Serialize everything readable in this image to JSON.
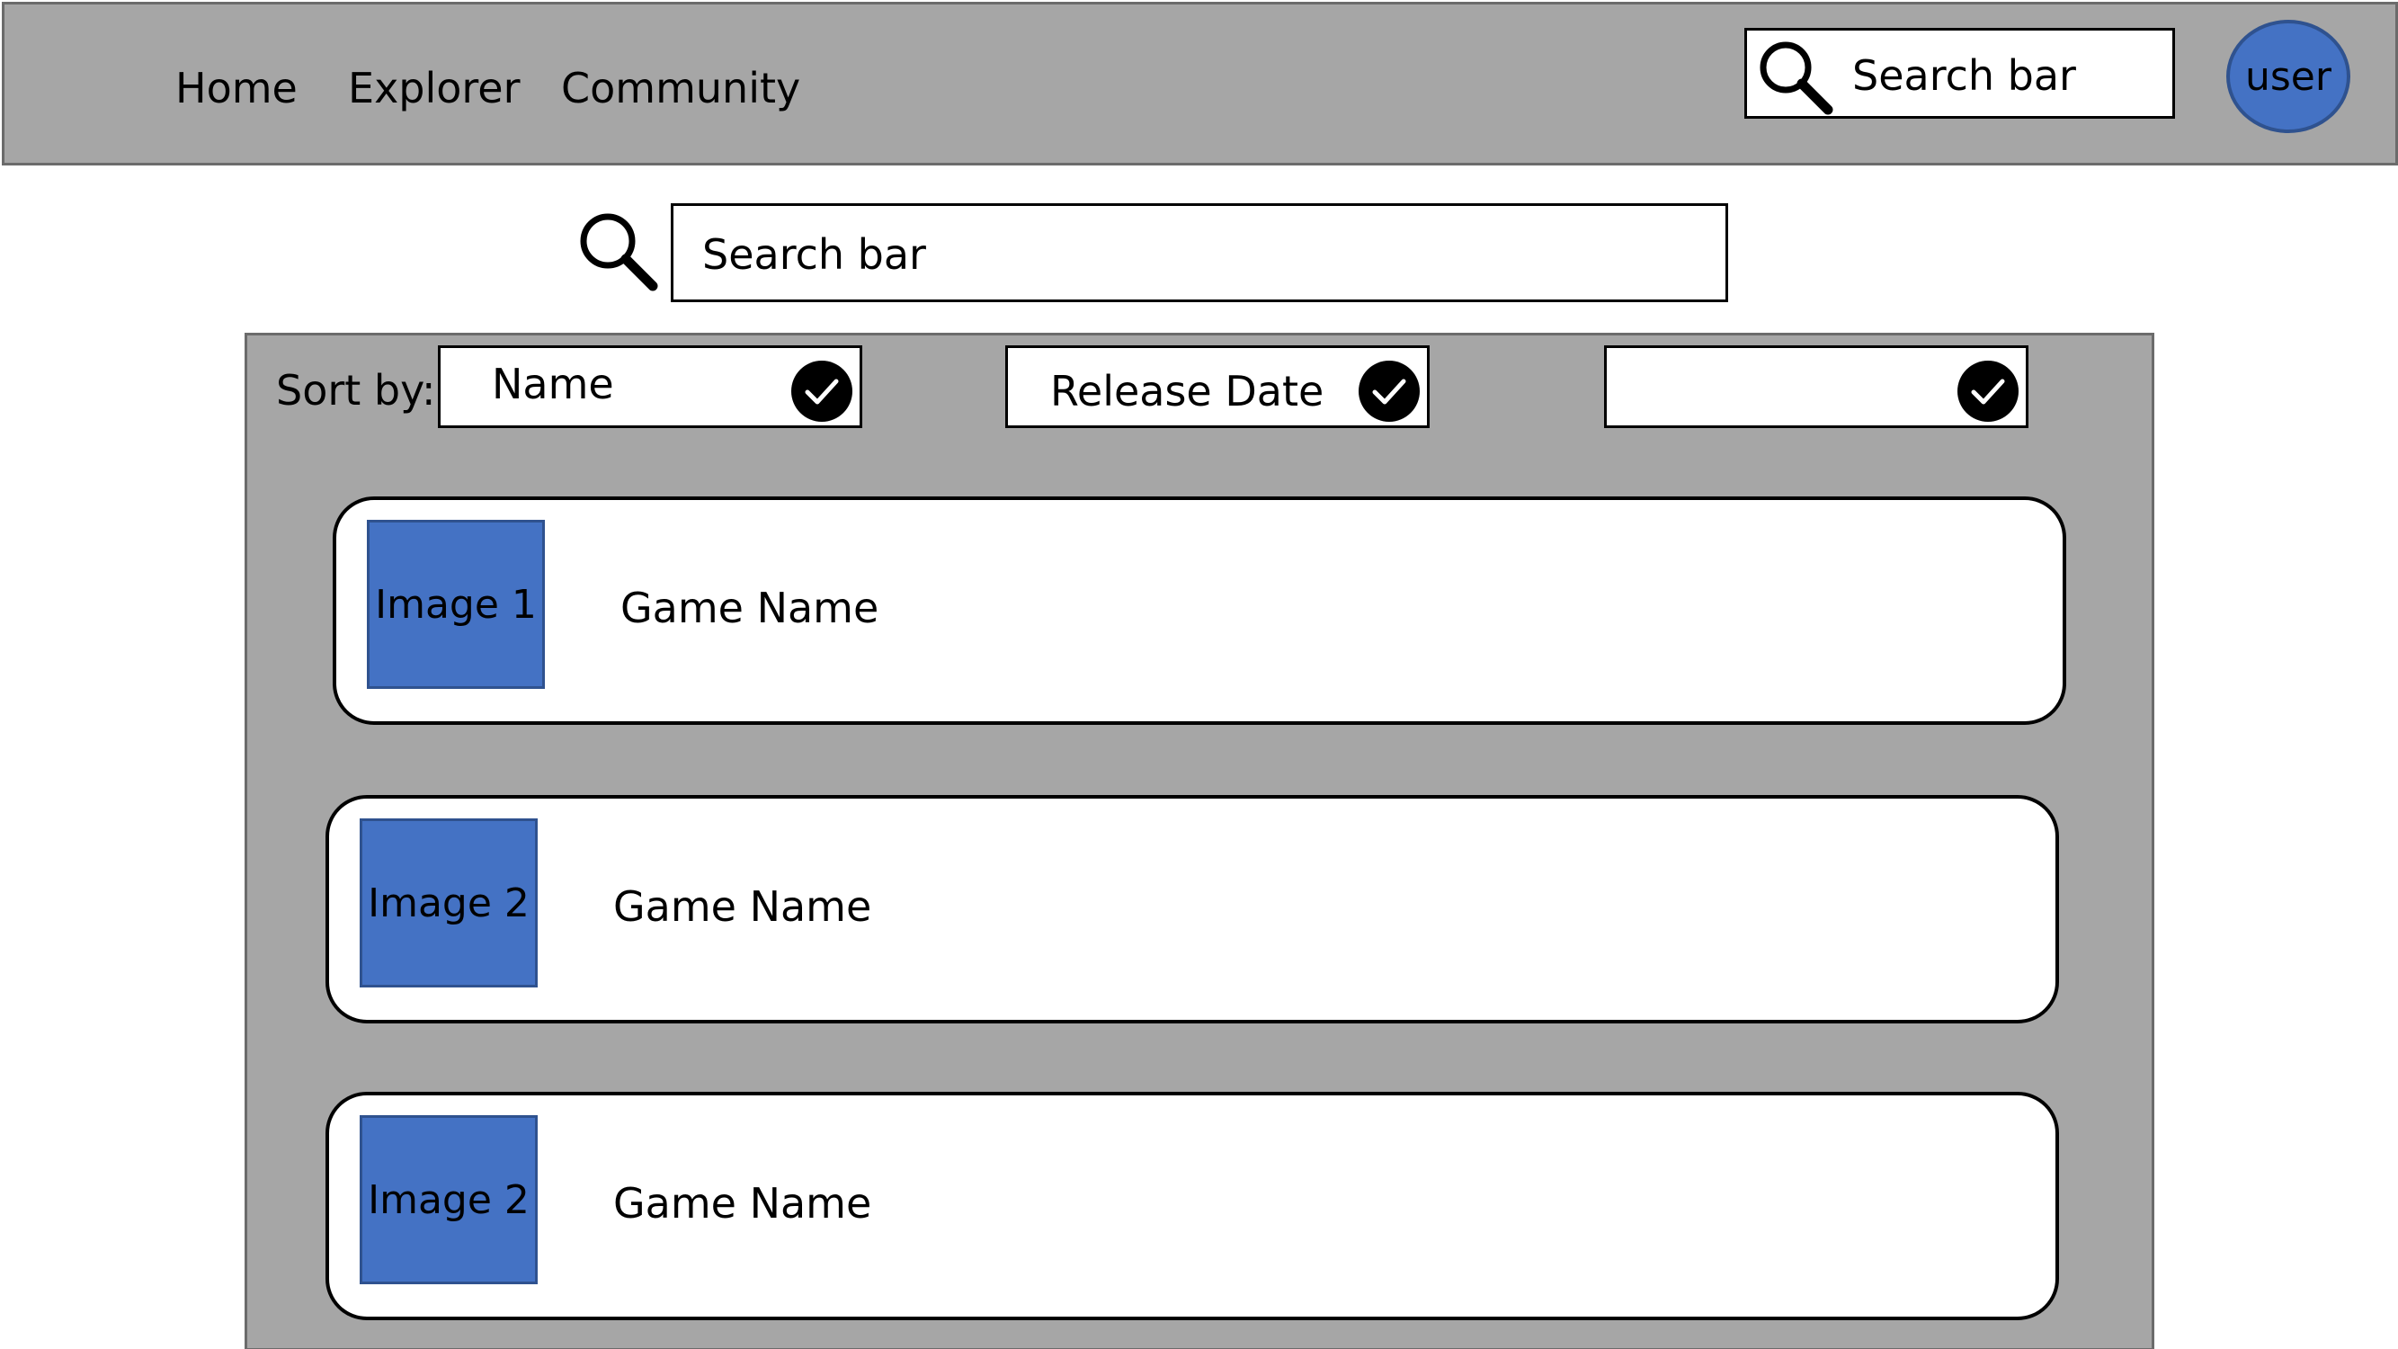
{
  "nav": {
    "links": [
      {
        "label": "Home"
      },
      {
        "label": "Explorer"
      },
      {
        "label": "Community"
      }
    ],
    "search": {
      "label": "Search bar",
      "icon": "search-icon"
    },
    "user": {
      "label": "user"
    }
  },
  "main_search": {
    "label": "Search bar",
    "icon": "search-icon"
  },
  "sort": {
    "label": "Sort by:",
    "options": [
      {
        "label": "Name",
        "checked": true
      },
      {
        "label": "Release Date",
        "checked": true
      },
      {
        "label": "",
        "checked": true
      }
    ]
  },
  "games": [
    {
      "image_label": "Image 1",
      "name": "Game Name"
    },
    {
      "image_label": "Image 2",
      "name": "Game Name"
    },
    {
      "image_label": "Image 2",
      "name": "Game Name"
    }
  ],
  "colors": {
    "bar_gray": "#a6a6a6",
    "accent_blue": "#4472c4",
    "accent_blue_border": "#2f528f"
  }
}
